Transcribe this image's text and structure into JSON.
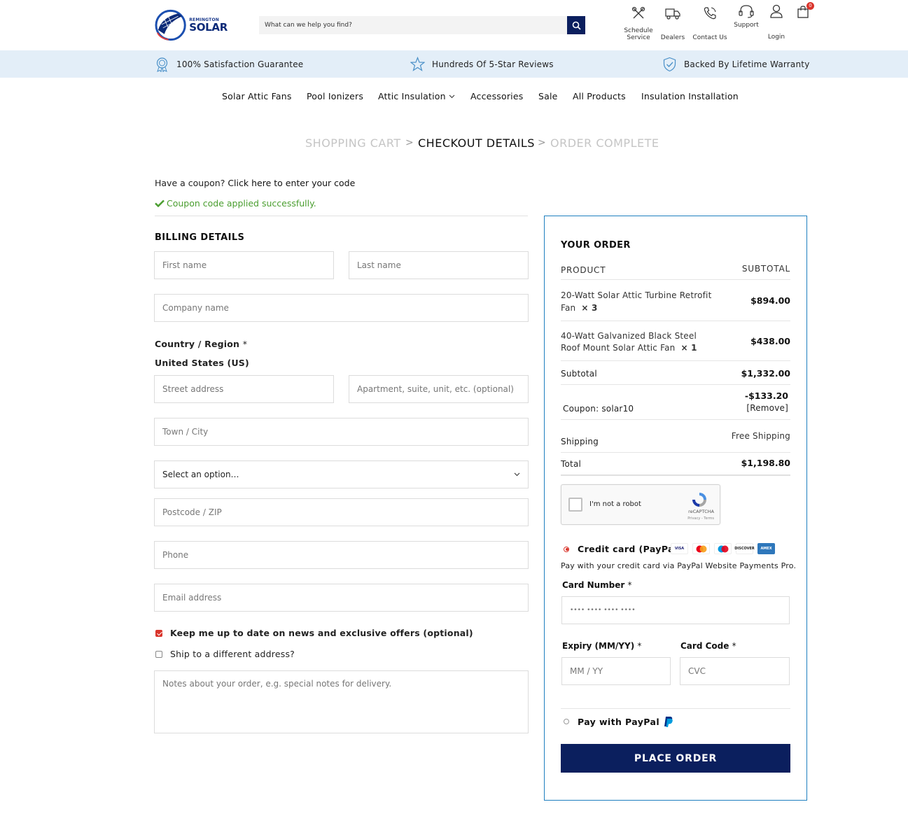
{
  "header": {
    "logo_small": "REMINGTON",
    "logo_big": "SOLAR",
    "search_placeholder": "What can we help you find?",
    "icons": [
      {
        "name": "schedule-service",
        "label": "Schedule\nService"
      },
      {
        "name": "dealers",
        "label": "Dealers"
      },
      {
        "name": "contact-us",
        "label": "Contact Us"
      },
      {
        "name": "support",
        "label": "Support"
      },
      {
        "name": "login",
        "label": "Login"
      }
    ],
    "cart_count": "0"
  },
  "trust": [
    {
      "icon": "award-icon",
      "text": "100% Satisfaction Guarantee"
    },
    {
      "icon": "star-icon",
      "text": "Hundreds Of 5-Star Reviews"
    },
    {
      "icon": "shield-check-icon",
      "text": "Backed By Lifetime Warranty"
    }
  ],
  "nav": [
    "Solar Attic Fans",
    "Pool Ionizers",
    "Attic Insulation",
    "Accessories",
    "Sale",
    "All Products",
    "Insulation Installation"
  ],
  "steps": [
    "SHOPPING CART",
    "CHECKOUT DETAILS",
    "ORDER COMPLETE"
  ],
  "coupon": {
    "prompt": "Have a coupon?",
    "link": "Click here to enter your code",
    "success": "Coupon code applied successfully."
  },
  "billing": {
    "title": "BILLING DETAILS",
    "first_name": "First name",
    "last_name": "Last name",
    "company": "Company name",
    "country_label": "Country / Region",
    "required_mark": "*",
    "country_value": "United States (US)",
    "street": "Street address",
    "apartment": "Apartment, suite, unit, etc. (optional)",
    "town": "Town / City",
    "state_select": "Select an option…",
    "postcode": "Postcode / ZIP",
    "phone": "Phone",
    "email": "Email address",
    "newsletter": "Keep me up to date on news and exclusive offers (optional)",
    "ship_different": "Ship to a different address?",
    "notes": "Notes about your order, e.g. special notes for delivery."
  },
  "order": {
    "title": "YOUR ORDER",
    "col_product": "PRODUCT",
    "col_subtotal": "SUBTOTAL",
    "items": [
      {
        "name_line1": "20-Watt Solar Attic Turbine Retrofit",
        "name_line2": "Fan",
        "qty": "× 3",
        "price": "$894.00"
      },
      {
        "name_line1": "40-Watt Galvanized Black Steel",
        "name_line2": "Roof Mount Solar Attic Fan",
        "qty": "× 1",
        "price": "$438.00"
      }
    ],
    "subtotal_label": "Subtotal",
    "subtotal_value": "$1,332.00",
    "coupon_label": "Coupon: solar10",
    "coupon_value": "-$133.20",
    "coupon_remove": "[Remove]",
    "shipping_label": "Shipping",
    "shipping_value": "Free Shipping",
    "total_label": "Total",
    "total_value": "$1,198.80",
    "recaptcha": {
      "label": "I'm not a robot",
      "brand": "reCAPTCHA",
      "terms": "Privacy - Terms"
    },
    "credit_card_label": "Credit card (PayPal)",
    "card_brands": [
      "VISA",
      "MC",
      "MAESTRO",
      "DISCOVER",
      "AMEX"
    ],
    "credit_card_desc": "Pay with your credit card via PayPal Website Payments Pro.",
    "card_number_label": "Card Number",
    "card_number_placeholder": "•••• •••• •••• ••••",
    "expiry_label": "Expiry (MM/YY)",
    "expiry_placeholder": "MM / YY",
    "card_code_label": "Card Code",
    "card_code_placeholder": "CVC",
    "paypal_label": "Pay with PayPal",
    "place_order": "PLACE ORDER"
  }
}
